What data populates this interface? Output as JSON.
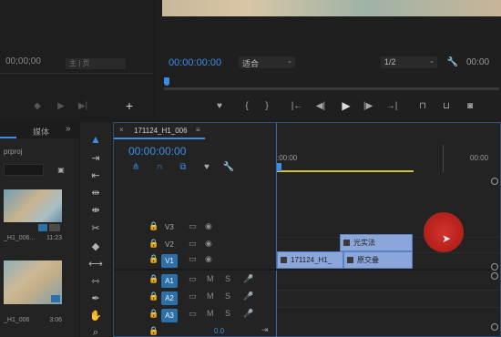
{
  "source_monitor": {
    "timecode": "00;00;00",
    "mini_label": "主 | 页"
  },
  "program_monitor": {
    "timecode": "00:00:00:00",
    "fit_label": "适合",
    "quality_label": "1/2",
    "right_timecode": "00:00"
  },
  "project_panel": {
    "tab_label": "媒体",
    "project_name": "prproj",
    "items": [
      {
        "name": "_H1_006...",
        "duration": "11:23"
      },
      {
        "name": "_H1_006",
        "duration": "3:06"
      }
    ]
  },
  "timeline": {
    "tab_label": "171124_H1_006",
    "timecode": "00:00:00:00",
    "ruler_start": ":00:00",
    "ruler_end": "00:00",
    "tracks": [
      {
        "name": "V3"
      },
      {
        "name": "V2"
      },
      {
        "name": "V1"
      },
      {
        "name": "A1",
        "m": "M",
        "s": "S"
      },
      {
        "name": "A2",
        "m": "M",
        "s": "S"
      },
      {
        "name": "A3",
        "m": "M",
        "s": "S"
      }
    ],
    "master_value": "0.0",
    "clips": {
      "fx_top": "光实法",
      "video_clip": "171124_H1_",
      "fx_bottom": "原交叠"
    }
  },
  "colors": {
    "accent": "#3d8ce6",
    "track_active": "#2d6fa8",
    "clip_fx": "#8aa6da",
    "cursor_highlight": "#c4221d"
  }
}
